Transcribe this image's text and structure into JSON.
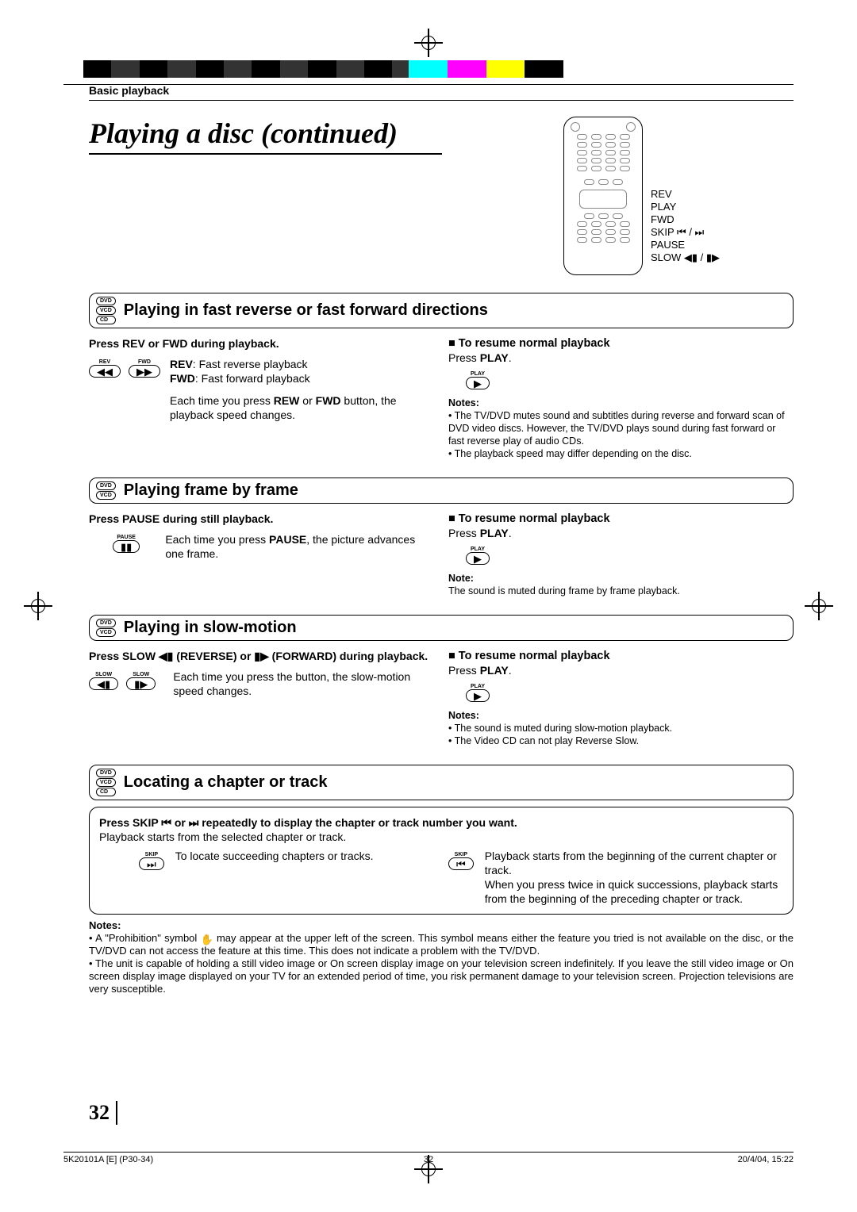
{
  "breadcrumb": "Basic playback",
  "title": "Playing a disc (continued)",
  "remote_labels": [
    "REV",
    "PLAY",
    "FWD",
    "SKIP ⏮ / ⏭",
    "PAUSE",
    "SLOW ◀▮ / ▮▶"
  ],
  "discs": {
    "dvd": "DVD",
    "vcd": "VCD",
    "cd": "CD"
  },
  "s1": {
    "title": "Playing in fast reverse or fast forward directions",
    "left": {
      "step": "Press REV or FWD during playback.",
      "btn_rev": "REV",
      "btn_fwd": "FWD",
      "sym_rev": "◀◀",
      "sym_fwd": "▶▶",
      "desc1_a": "REV",
      "desc1_b": ":  Fast reverse playback",
      "desc2_a": "FWD",
      "desc2_b": ": Fast forward playback",
      "desc3_a": "Each time you press ",
      "desc3_b": "REW",
      "desc3_c": " or ",
      "desc3_d": "FWD",
      "desc3_e": " button, the playback speed changes."
    },
    "right": {
      "hdr": "To resume normal playback",
      "press_a": "Press ",
      "press_b": "PLAY",
      "press_c": ".",
      "btn_cap": "PLAY",
      "btn_sym": "▶",
      "notes_h": "Notes:",
      "n1": "The TV/DVD mutes sound and subtitles during reverse and forward scan of DVD video discs. However, the TV/DVD plays sound during fast forward or fast reverse play of audio CDs.",
      "n2": "The playback speed may differ depending on the disc."
    }
  },
  "s2": {
    "title": "Playing frame by frame",
    "left": {
      "step": "Press PAUSE during still playback.",
      "btn_cap": "PAUSE",
      "btn_sym": "▮▮",
      "desc_a": "Each time you press ",
      "desc_b": "PAUSE",
      "desc_c": ", the picture advances one frame."
    },
    "right": {
      "hdr": "To resume normal playback",
      "press_a": "Press ",
      "press_b": "PLAY",
      "press_c": ".",
      "btn_cap": "PLAY",
      "btn_sym": "▶",
      "notes_h": "Note:",
      "n1": "The sound is muted during frame by frame playback."
    }
  },
  "s3": {
    "title": "Playing in slow-motion",
    "left": {
      "step_a": "Press SLOW ◀▮ (REVERSE) or ▮▶ (FORWARD) during playback.",
      "btn_cap": "SLOW",
      "sym_l": "◀▮",
      "sym_r": "▮▶",
      "desc": "Each time you press the button, the slow-motion speed changes."
    },
    "right": {
      "hdr": "To resume normal playback",
      "press_a": "Press ",
      "press_b": "PLAY",
      "press_c": ".",
      "btn_cap": "PLAY",
      "btn_sym": "▶",
      "notes_h": "Notes:",
      "n1": "The sound is muted during slow-motion playback.",
      "n2": "The Video CD can not play Reverse Slow."
    }
  },
  "s4": {
    "title": "Locating a chapter or track",
    "step": "Press SKIP ⏮ or ⏭ repeatedly to display the chapter or track number you want.",
    "sub": "Playback starts from the selected chapter or track.",
    "btn_cap": "SKIP",
    "sym_next": "⏭",
    "sym_prev": "⏮",
    "l_desc": "To locate succeeding chapters or tracks.",
    "r_desc": "Playback starts from the beginning of the current chapter or track.\nWhen you press twice in quick successions, playback starts from the beginning of the preceding chapter or track."
  },
  "bottom_notes": {
    "h": "Notes:",
    "n1_a": "A \"Prohibition\" symbol ",
    "n1_b": " may appear at the upper left of the screen. This symbol means either the feature you tried is not available on the disc, or the TV/DVD can not access the feature at this time. This does not indicate a problem with the TV/DVD.",
    "n2": "The unit is capable of holding a still video image or On screen display image on your television screen indefinitely.  If you leave the still video image or On screen display image displayed on your TV for an extended period of time, you risk permanent damage to your television screen.  Projection televisions are very susceptible."
  },
  "page_number": "32",
  "footer": {
    "left": "5K20101A [E] (P30-34)",
    "mid": "32",
    "right": "20/4/04, 15:22"
  }
}
